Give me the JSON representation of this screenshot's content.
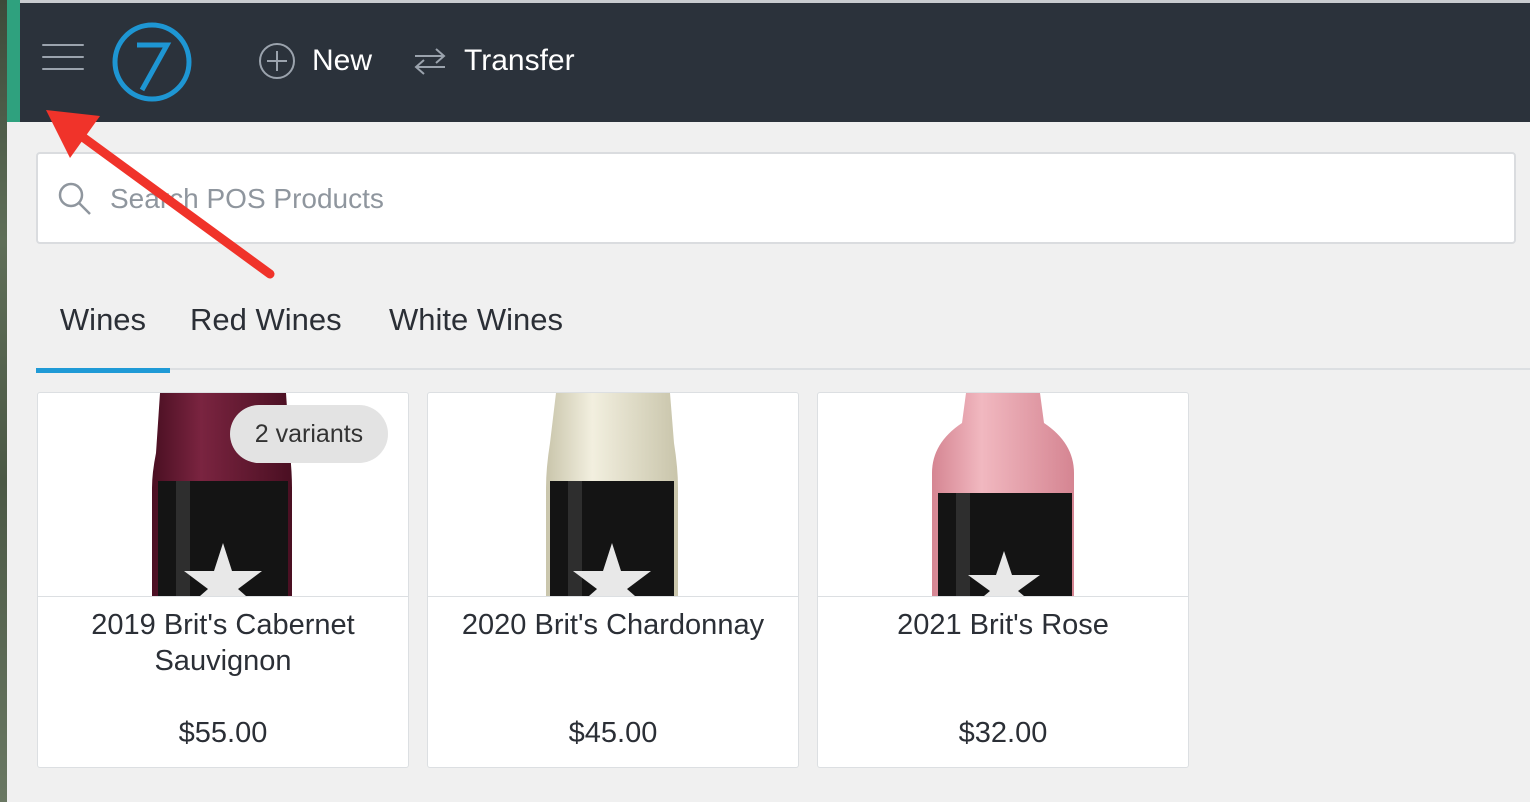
{
  "topbar": {
    "menu_icon": "hamburger-icon",
    "logo_icon": "z-logo-icon",
    "new_label": "New",
    "transfer_label": "Transfer",
    "accent_color": "#2fa17e",
    "bar_color": "#2b323b"
  },
  "search": {
    "placeholder": "Search POS Products",
    "value": ""
  },
  "tabs": [
    {
      "label": "Wines",
      "active": true
    },
    {
      "label": "Red Wines",
      "active": false
    },
    {
      "label": "White Wines",
      "active": false
    }
  ],
  "products": [
    {
      "name": "2019 Brit's Cabernet Sauvignon",
      "price": "$55.00",
      "badge": "2 variants",
      "bottle_color": "#6b1b35"
    },
    {
      "name": "2020 Brit's Chardonnay",
      "price": "$45.00",
      "badge": "",
      "bottle_color": "#e6e2cd"
    },
    {
      "name": "2021 Brit's Rose",
      "price": "$32.00",
      "badge": "",
      "bottle_color": "#e8a2ad"
    }
  ],
  "annotation": {
    "arrow_color": "#f0332a"
  }
}
